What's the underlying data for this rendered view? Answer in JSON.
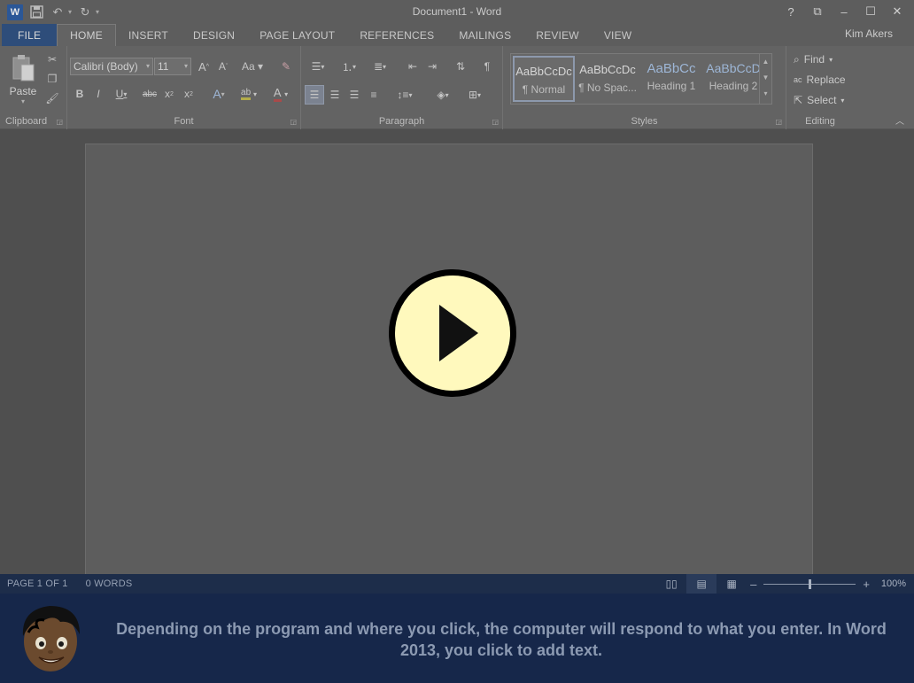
{
  "title_bar": {
    "document_title": "Document1 - Word",
    "qat_icons": [
      "word-app-icon",
      "save-icon",
      "undo-icon",
      "redo-icon",
      "customize-qat-icon"
    ],
    "window_controls": [
      "?",
      "⧉",
      "–",
      "☐",
      "✕"
    ]
  },
  "tabs": [
    {
      "label": "FILE"
    },
    {
      "label": "HOME"
    },
    {
      "label": "INSERT"
    },
    {
      "label": "DESIGN"
    },
    {
      "label": "PAGE LAYOUT"
    },
    {
      "label": "REFERENCES"
    },
    {
      "label": "MAILINGS"
    },
    {
      "label": "REVIEW"
    },
    {
      "label": "VIEW"
    }
  ],
  "user": {
    "name": "Kim Akers"
  },
  "ribbon": {
    "clipboard": {
      "label": "Clipboard",
      "paste_label": "Paste"
    },
    "font": {
      "label": "Font",
      "font_name": "Calibri (Body)",
      "font_size": "11"
    },
    "paragraph": {
      "label": "Paragraph"
    },
    "styles": {
      "label": "Styles",
      "items": [
        {
          "sample": "AaBbCcDc",
          "name": "¶ Normal"
        },
        {
          "sample": "AaBbCcDc",
          "name": "¶ No Spac..."
        },
        {
          "sample": "AaBbCc",
          "name": "Heading 1"
        },
        {
          "sample": "AaBbCcD",
          "name": "Heading 2"
        }
      ]
    },
    "editing": {
      "label": "Editing",
      "find": "Find",
      "replace": "Replace",
      "select": "Select"
    }
  },
  "status": {
    "page": "PAGE 1 OF 1",
    "words": "0 WORDS",
    "zoom": "100%",
    "zoom_fraction": 0.5
  },
  "narration": {
    "text": "Depending on the program and where you click, the computer will respond to what you enter. In Word 2013, you click to add text."
  },
  "colors": {
    "file_tab": "#2e4d7a",
    "status_bar": "#1d2d4a",
    "narration_bar": "#16274a",
    "play_fill": "#fff9bd"
  }
}
